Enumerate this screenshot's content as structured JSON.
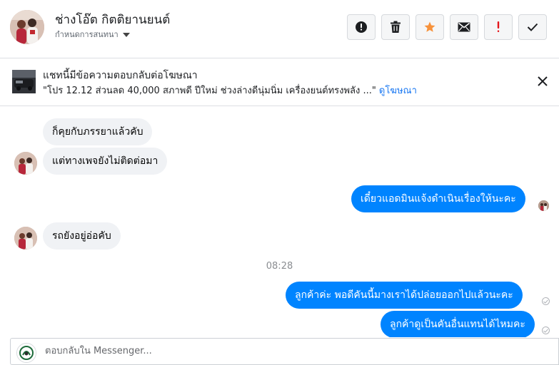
{
  "header": {
    "contact_name": "ช่างโอ๊ต กิตติยานยนต์",
    "assign_label": "กำหนดการสนทนา",
    "actions": [
      {
        "icon": "alert-circle-icon"
      },
      {
        "icon": "trash-icon"
      },
      {
        "icon": "star-icon",
        "color": "#f7923b"
      },
      {
        "icon": "envelope-icon"
      },
      {
        "icon": "exclamation-icon",
        "color": "#e4161b"
      },
      {
        "icon": "checkmark-icon"
      }
    ]
  },
  "ad_banner": {
    "title": "แชทนี้มีข้อความตอบกลับต่อโฆษณา",
    "quote": "\"โปร 12.12 ส่วนลด 40,000 สภาพดี ปีใหม่ ช่วงล่างดีนุ่มนิ่ม เครื่องยนต์ทรงพลัง ...\"",
    "link": "ดูโฆษณา"
  },
  "messages": [
    {
      "direction": "in",
      "text": "ก็คุยกับภรรยาแล้วคับ"
    },
    {
      "direction": "in",
      "text": "แต่ทางเพจยังไม่ติดต่อมา"
    },
    {
      "direction": "out",
      "text": "เดี๋ยวแอดมินแจ้งดำเนินเรื่องให้นะคะ"
    },
    {
      "direction": "in",
      "text": "รถยังอยู่อ่อคับ"
    },
    {
      "direction": "out",
      "text": "ลูกค้าค่ะ พอดีคันนี้มางเราได้ปล่อยออกไปแล้วนะคะ"
    },
    {
      "direction": "out",
      "text": "ลูกค้าดูเป็นคันอื่นแทนได้ไหมคะ"
    }
  ],
  "timestamp": "08:28",
  "composer": {
    "placeholder": "ตอบกลับใน Messenger..."
  },
  "colors": {
    "accent": "#0084ff",
    "incoming_bubble": "#f0f2f5",
    "link": "#1877f2"
  }
}
